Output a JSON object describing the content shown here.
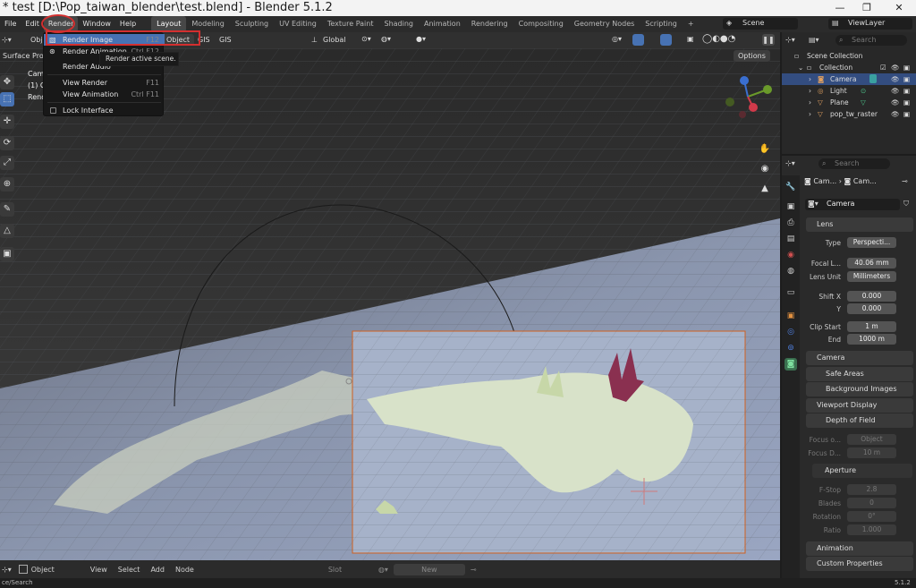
{
  "window": {
    "title": "* test [D:\\Pop_taiwan_blender\\test.blend] - Blender 5.1.2",
    "controls": [
      "—",
      "❐",
      "✕"
    ]
  },
  "topbar": {
    "menus": [
      "File",
      "Edit",
      "Render",
      "Window",
      "Help"
    ],
    "workspaces": [
      "Layout",
      "Modeling",
      "Sculpting",
      "UV Editing",
      "Texture Paint",
      "Shading",
      "Animation",
      "Rendering",
      "Compositing",
      "Geometry Nodes",
      "Scripting"
    ],
    "active_workspace": "Layout",
    "add_workspace": "+",
    "scene": "Scene",
    "view_layer": "ViewLayer"
  },
  "viewport_header": {
    "mode": "Obj",
    "object_menu": "Object",
    "gis_menus": [
      "GIS",
      "GIS"
    ],
    "transform_orientation": "Global",
    "options": "Options",
    "surface_proj": "Surface Proje"
  },
  "viewport_overlay": {
    "line1": "Came",
    "line2": "(1) C",
    "line3": "Rend"
  },
  "render_menu": {
    "items": [
      {
        "label": "Render Image",
        "shortcut": "F12"
      },
      {
        "label": "Render Animation",
        "shortcut": "Ctrl F12"
      },
      {
        "label": "Render Audio",
        "shortcut": ""
      },
      {
        "label": "View Render",
        "shortcut": "F11"
      },
      {
        "label": "View Animation",
        "shortcut": "Ctrl F11"
      },
      {
        "label": "Lock Interface",
        "shortcut": ""
      }
    ],
    "tooltip": "Render active scene."
  },
  "bottombar": {
    "mode": "Object",
    "menus": [
      "View",
      "Select",
      "Add",
      "Node"
    ],
    "slot": "Slot",
    "new_button": "New"
  },
  "statusbar": {
    "left": "ce/Search",
    "version": "5.1.2"
  },
  "outliner": {
    "search_placeholder": "Search",
    "items": [
      {
        "label": "Scene Collection",
        "indent": 0
      },
      {
        "label": "Collection",
        "indent": 1
      },
      {
        "label": "Camera",
        "indent": 2
      },
      {
        "label": "Light",
        "indent": 2
      },
      {
        "label": "Plane",
        "indent": 2
      },
      {
        "label": "pop_tw_raster",
        "indent": 2
      }
    ]
  },
  "properties": {
    "search_placeholder": "Search",
    "breadcrumb": [
      "Cam...",
      "Cam..."
    ],
    "datablock": "Camera",
    "lens_panel": "Lens",
    "type_label": "Type",
    "type_value": "Perspecti...",
    "focal_label": "Focal L...",
    "focal_value": "40.06 mm",
    "lens_unit_label": "Lens Unit",
    "lens_unit_value": "Millimeters",
    "shift_x_label": "Shift X",
    "shift_x_value": "0.000",
    "shift_y_label": "Y",
    "shift_y_value": "0.000",
    "clip_start_label": "Clip Start",
    "clip_start_value": "1 m",
    "clip_end_label": "End",
    "clip_end_value": "1000 m",
    "panels": [
      "Camera",
      "Safe Areas",
      "Background Images",
      "Viewport Display",
      "Depth of Field"
    ],
    "focus_object_label": "Focus o...",
    "focus_object_value": "Object",
    "focus_distance_label": "Focus D...",
    "focus_distance_value": "10 m",
    "aperture_panel": "Aperture",
    "fstop_label": "F-Stop",
    "fstop_value": "2.8",
    "blades_label": "Blades",
    "blades_value": "0",
    "rotation_label": "Rotation",
    "rotation_value": "0°",
    "ratio_label": "Ratio",
    "ratio_value": "1.000",
    "animation_panel": "Animation",
    "custom_props_panel": "Custom Properties"
  },
  "colors": {
    "accent": "#4772b3",
    "highlight_red": "#d32f2f",
    "camera_frame": "#d0601f"
  }
}
